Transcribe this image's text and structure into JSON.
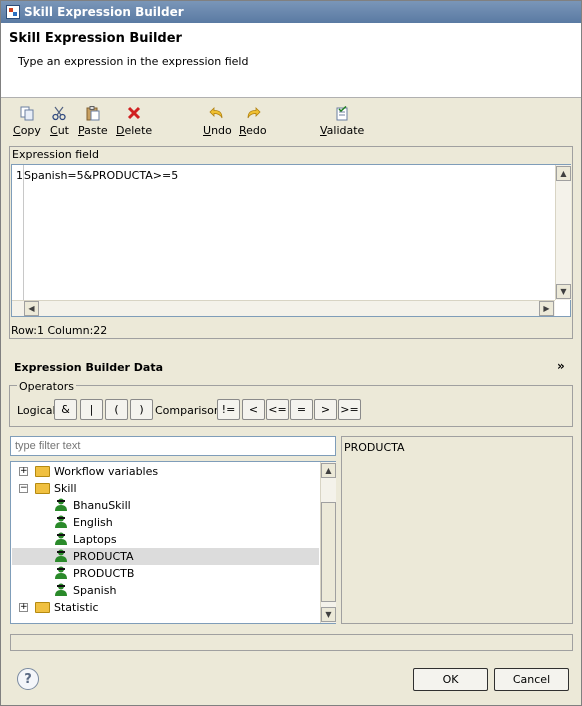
{
  "window": {
    "title": "Skill Expression Builder"
  },
  "header": {
    "title": "Skill Expression Builder",
    "description": "Type an expression in the expression field"
  },
  "toolbar": {
    "copy": "Copy",
    "cut": "Cut",
    "paste": "Paste",
    "delete": "Delete",
    "undo": "Undo",
    "redo": "Redo",
    "validate": "Validate"
  },
  "expression": {
    "label": "Expression field",
    "line_number": "1",
    "value": "Spanish=5&PRODUCTA>=5",
    "status": "Row:1 Column:22"
  },
  "builder": {
    "title": "Expression Builder Data",
    "operators_label": "Operators",
    "logical_label": "Logical",
    "logical_ops": [
      "&",
      "|",
      "(",
      ")"
    ],
    "comparison_label": "Comparison",
    "comparison_ops": [
      "!=",
      "<",
      "<=",
      "=",
      ">",
      ">="
    ]
  },
  "filter": {
    "placeholder": "type filter text"
  },
  "tree": {
    "items": [
      {
        "label": "Workflow variables",
        "type": "folder",
        "expanded": false
      },
      {
        "label": "Skill",
        "type": "folder",
        "expanded": true
      },
      {
        "label": "BhanuSkill",
        "type": "skill"
      },
      {
        "label": "English",
        "type": "skill"
      },
      {
        "label": "Laptops",
        "type": "skill"
      },
      {
        "label": "PRODUCTA",
        "type": "skill",
        "selected": true
      },
      {
        "label": "PRODUCTB",
        "type": "skill"
      },
      {
        "label": "Spanish",
        "type": "skill"
      },
      {
        "label": "Statistic",
        "type": "folder",
        "expanded": false
      }
    ]
  },
  "detail": {
    "value": "PRODUCTA"
  },
  "footer": {
    "ok": "OK",
    "cancel": "Cancel"
  },
  "colors": {
    "titlebar": "#5a7aa3",
    "selection": "#dcdcdc",
    "delete": "#d02020",
    "folder": "#f0c040",
    "skill": "#2a8a2a"
  }
}
